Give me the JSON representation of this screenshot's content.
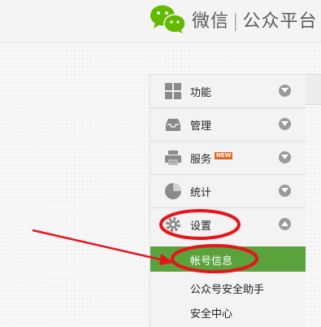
{
  "header": {
    "logo_main": "微信",
    "logo_sep": "|",
    "logo_sub": "公众平台"
  },
  "menu": {
    "items": [
      {
        "label": "功能",
        "icon": "grid-icon"
      },
      {
        "label": "管理",
        "icon": "inbox-icon"
      },
      {
        "label": "服务",
        "icon": "printer-icon",
        "badge": "NEW"
      },
      {
        "label": "统计",
        "icon": "pie-chart-icon"
      },
      {
        "label": "设置",
        "icon": "gear-icon"
      }
    ],
    "submenu": [
      {
        "label": "帐号信息",
        "active": true
      },
      {
        "label": "公众号安全助手"
      },
      {
        "label": "安全中心"
      }
    ]
  },
  "colors": {
    "accent_green": "#5aa33c",
    "annotation_red": "#e8141c",
    "badge_orange": "#e8661e"
  }
}
